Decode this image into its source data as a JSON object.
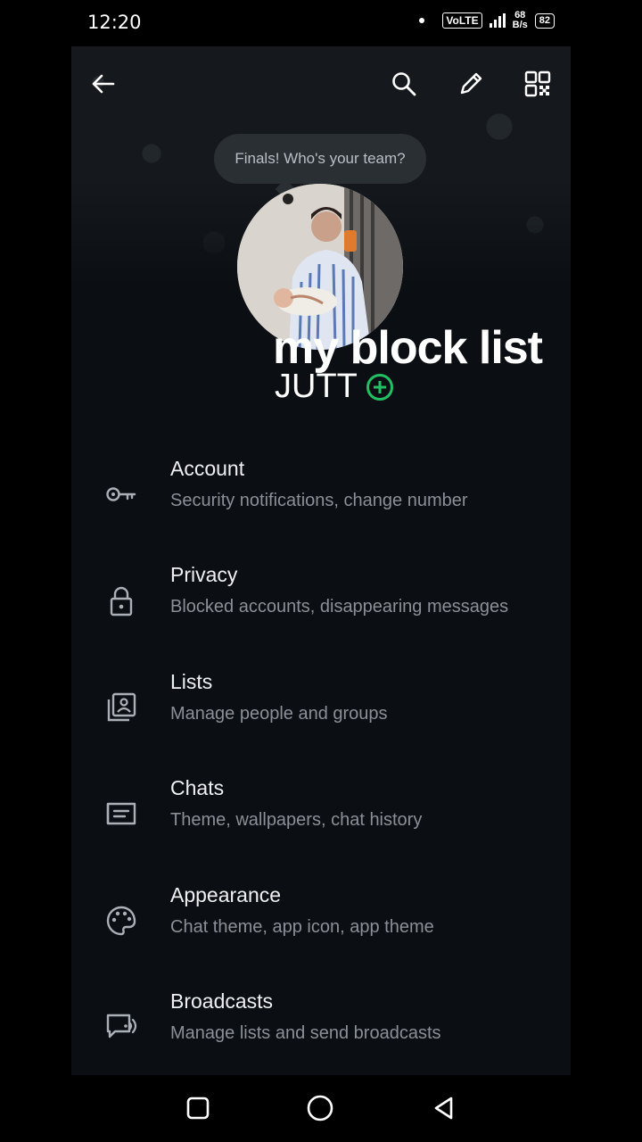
{
  "status_bar": {
    "time": "12:20",
    "volte": "VoLTE",
    "speed_value": "68",
    "speed_unit": "B/s",
    "battery": "82"
  },
  "toolbar": {
    "back_icon": "arrow-left-icon",
    "search_icon": "search-icon",
    "edit_icon": "pencil-icon",
    "qr_icon": "qr-code-icon"
  },
  "profile": {
    "note": "Finals! Who's your team?",
    "name": "my block list",
    "subtitle": "JUTT",
    "accent": "#21c063"
  },
  "menu": [
    {
      "title": "Account",
      "subtitle": "Security notifications, change number",
      "icon": "key-icon"
    },
    {
      "title": "Privacy",
      "subtitle": "Blocked accounts, disappearing messages",
      "icon": "lock-icon"
    },
    {
      "title": "Lists",
      "subtitle": "Manage people and groups",
      "icon": "contact-list-icon"
    },
    {
      "title": "Chats",
      "subtitle": "Theme, wallpapers, chat history",
      "icon": "chat-icon"
    },
    {
      "title": "Appearance",
      "subtitle": "Chat theme, app icon, app theme",
      "icon": "palette-icon"
    },
    {
      "title": "Broadcasts",
      "subtitle": "Manage lists and send broadcasts",
      "icon": "broadcast-icon"
    }
  ],
  "nav": {
    "recents_icon": "square-recents-icon",
    "home_icon": "circle-home-icon",
    "back_icon": "triangle-back-icon"
  }
}
